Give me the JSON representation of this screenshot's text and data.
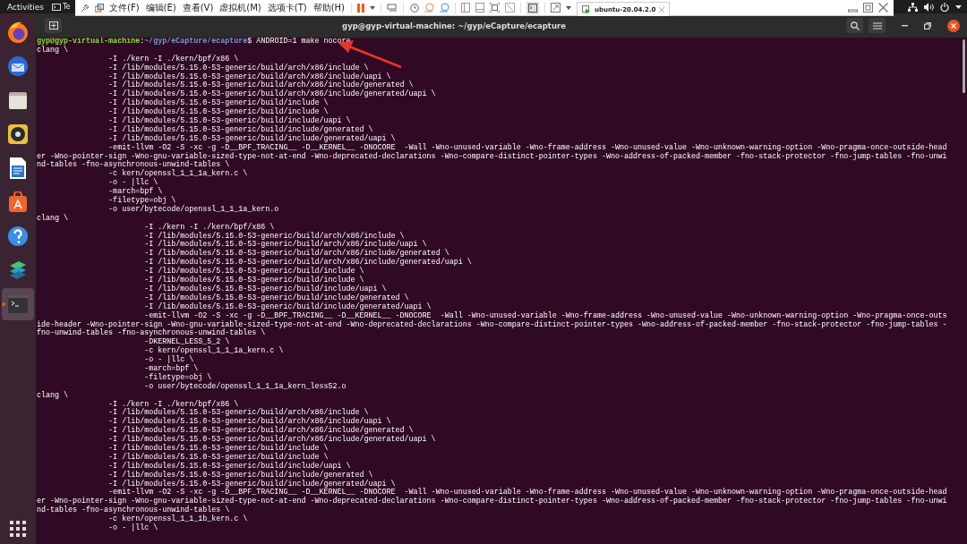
{
  "top_bar": {
    "activities": "Activities",
    "app_menu": "Te"
  },
  "vm_toolbar": {
    "menus": [
      "文件(F)",
      "编辑(E)",
      "查看(V)",
      "虚拟机(M)",
      "选项卡(T)",
      "帮助(H)"
    ],
    "tab": {
      "label": "ubuntu-20.04.2.0"
    }
  },
  "dock": {
    "items": [
      {
        "kind": "firefox",
        "selected": false
      },
      {
        "kind": "mail",
        "selected": false
      },
      {
        "kind": "files",
        "selected": false
      },
      {
        "kind": "music",
        "selected": false
      },
      {
        "kind": "writer",
        "selected": false
      },
      {
        "kind": "store",
        "selected": false
      },
      {
        "kind": "help",
        "selected": false
      },
      {
        "kind": "layers",
        "selected": false
      },
      {
        "kind": "terminal",
        "selected": true
      }
    ]
  },
  "terminal": {
    "title": "gyp@gyp-virtual-machine: ~/gyp/eCapture/ecapture",
    "prompt": {
      "user_host": "gyp@gyp-virtual-machine",
      "colon": ":",
      "path": "~/gyp/eCapture/ecapture",
      "dollar": "$",
      "command": " ANDROID=1 make nocore"
    },
    "lines": [
      "clang \\",
      "                -I ./kern -I ./kern/bpf/x86 \\",
      "                -I /lib/modules/5.15.0-53-generic/build/arch/x86/include \\",
      "                -I /lib/modules/5.15.0-53-generic/build/arch/x86/include/uapi \\",
      "                -I /lib/modules/5.15.0-53-generic/build/arch/x86/include/generated \\",
      "                -I /lib/modules/5.15.0-53-generic/build/arch/x86/include/generated/uapi \\",
      "                -I /lib/modules/5.15.0-53-generic/build/include \\",
      "                -I /lib/modules/5.15.0-53-generic/build/include \\",
      "                -I /lib/modules/5.15.0-53-generic/build/include/uapi \\",
      "                -I /lib/modules/5.15.0-53-generic/build/include/generated \\",
      "                -I /lib/modules/5.15.0-53-generic/build/include/generated/uapi \\",
      "                -emit-llvm -O2 -S -xc -g -D__BPF_TRACING__ -D__KERNEL__ -DNOCORE  -Wall -Wno-unused-variable -Wno-frame-address -Wno-unused-value -Wno-unknown-warning-option -Wno-pragma-once-outside-head",
      "er -Wno-pointer-sign -Wno-gnu-variable-sized-type-not-at-end -Wno-deprecated-declarations -Wno-compare-distinct-pointer-types -Wno-address-of-packed-member -fno-stack-protector -fno-jump-tables -fno-unwi",
      "nd-tables -fno-asynchronous-unwind-tables \\",
      "                -c kern/openssl_1_1_1a_kern.c \\",
      "                -o - |llc \\",
      "                -march=bpf \\",
      "                -filetype=obj \\",
      "                -o user/bytecode/openssl_1_1_1a_kern.o",
      "clang \\",
      "                        -I ./kern -I ./kern/bpf/x86 \\",
      "                        -I /lib/modules/5.15.0-53-generic/build/arch/x86/include \\",
      "                        -I /lib/modules/5.15.0-53-generic/build/arch/x86/include/uapi \\",
      "                        -I /lib/modules/5.15.0-53-generic/build/arch/x86/include/generated \\",
      "                        -I /lib/modules/5.15.0-53-generic/build/arch/x86/include/generated/uapi \\",
      "                        -I /lib/modules/5.15.0-53-generic/build/include \\",
      "                        -I /lib/modules/5.15.0-53-generic/build/include \\",
      "                        -I /lib/modules/5.15.0-53-generic/build/include/uapi \\",
      "                        -I /lib/modules/5.15.0-53-generic/build/include/generated \\",
      "                        -I /lib/modules/5.15.0-53-generic/build/include/generated/uapi \\",
      "                        -emit-llvm -O2 -S -xc -g -D__BPF_TRACING__ -D__KERNEL__ -DNOCORE  -Wall -Wno-unused-variable -Wno-frame-address -Wno-unused-value -Wno-unknown-warning-option -Wno-pragma-once-outs",
      "ide-header -Wno-pointer-sign -Wno-gnu-variable-sized-type-not-at-end -Wno-deprecated-declarations -Wno-compare-distinct-pointer-types -Wno-address-of-packed-member -fno-stack-protector -fno-jump-tables -",
      "fno-unwind-tables -fno-asynchronous-unwind-tables \\",
      "                        -DKERNEL_LESS_5_2 \\",
      "                        -c kern/openssl_1_1_1a_kern.c \\",
      "                        -o - |llc \\",
      "                        -march=bpf \\",
      "                        -filetype=obj \\",
      "                        -o user/bytecode/openssl_1_1_1a_kern_less52.o",
      "clang \\",
      "                -I ./kern -I ./kern/bpf/x86 \\",
      "                -I /lib/modules/5.15.0-53-generic/build/arch/x86/include \\",
      "                -I /lib/modules/5.15.0-53-generic/build/arch/x86/include/uapi \\",
      "                -I /lib/modules/5.15.0-53-generic/build/arch/x86/include/generated \\",
      "                -I /lib/modules/5.15.0-53-generic/build/arch/x86/include/generated/uapi \\",
      "                -I /lib/modules/5.15.0-53-generic/build/include \\",
      "                -I /lib/modules/5.15.0-53-generic/build/include \\",
      "                -I /lib/modules/5.15.0-53-generic/build/include/uapi \\",
      "                -I /lib/modules/5.15.0-53-generic/build/include/generated \\",
      "                -I /lib/modules/5.15.0-53-generic/build/include/generated/uapi \\",
      "                -emit-llvm -O2 -S -xc -g -D__BPF_TRACING__ -D__KERNEL__ -DNOCORE  -Wall -Wno-unused-variable -Wno-frame-address -Wno-unused-value -Wno-unknown-warning-option -Wno-pragma-once-outside-head",
      "er -Wno-pointer-sign -Wno-gnu-variable-sized-type-not-at-end -Wno-deprecated-declarations -Wno-compare-distinct-pointer-types -Wno-address-of-packed-member -fno-stack-protector -fno-jump-tables -fno-unwi",
      "nd-tables -fno-asynchronous-unwind-tables \\",
      "                -c kern/openssl_1_1_1b_kern.c \\",
      "                -o - |llc \\"
    ]
  }
}
